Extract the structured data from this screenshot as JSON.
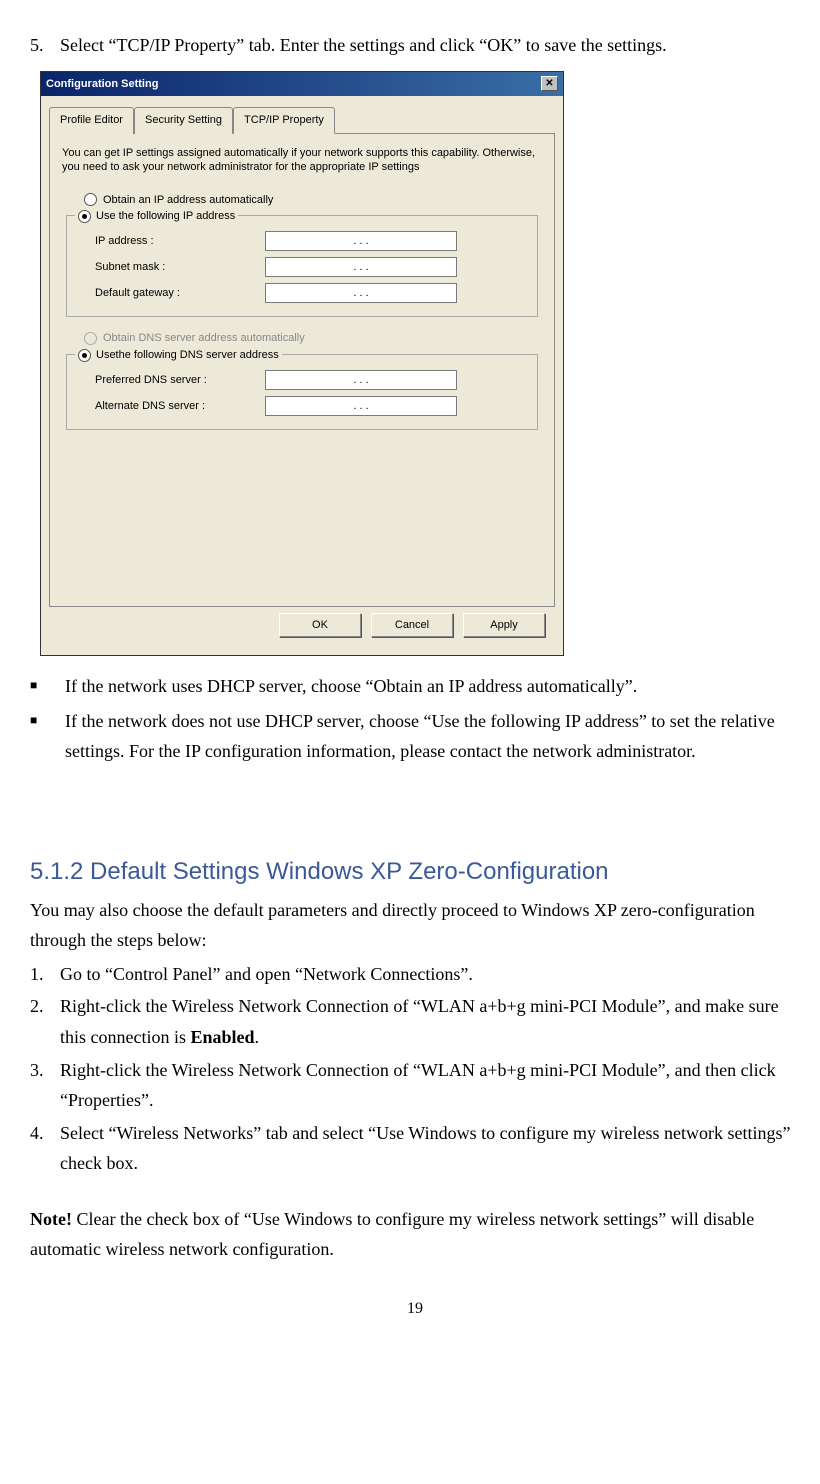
{
  "step5": {
    "num": "5.",
    "text": "Select “TCP/IP Property” tab.  Enter the settings and click “OK” to save the settings."
  },
  "dialog": {
    "title": "Configuration Setting",
    "close": "✕",
    "tabs": {
      "profile": "Profile Editor",
      "security": "Security Setting",
      "tcpip": "TCP/IP Property"
    },
    "intro": "You can get IP settings assigned automatically if your network supports this capability. Otherwise, you need to ask your network administrator for the appropriate IP settings",
    "radio_obtain_ip": "Obtain an IP address automatically",
    "radio_use_ip": "Use the following IP address",
    "ip_label": "IP address :",
    "subnet_label": "Subnet mask :",
    "gateway_label": "Default gateway :",
    "radio_obtain_dns": "Obtain DNS server address automatically",
    "radio_use_dns": "Usethe following DNS server address",
    "pref_dns_label": "Preferred DNS server :",
    "alt_dns_label": "Alternate DNS server :",
    "dots": ".          .          .",
    "ok": "OK",
    "cancel": "Cancel",
    "apply": "Apply"
  },
  "bullets": {
    "b1": "If the network uses DHCP server, choose “Obtain an IP address automatically”.",
    "b2": "If the network does not use DHCP server, choose “Use the following IP address” to set the relative settings.  For the IP configuration information, please contact the network administrator."
  },
  "section": {
    "title": "5.1.2 Default Settings Windows XP Zero-Configuration",
    "intro": "You may also choose the default parameters and directly proceed to Windows XP zero-configuration through the steps below:"
  },
  "steps": {
    "s1num": "1.",
    "s1": "Go to “Control Panel” and open “Network Connections”.",
    "s2num": "2.",
    "s2a": "Right-click the Wireless Network Connection of “WLAN a+b+g mini-PCI Module”, and make sure this connection is ",
    "s2b": "Enabled",
    "s2c": ".",
    "s3num": "3.",
    "s3": "Right-click the Wireless Network Connection of “WLAN a+b+g mini-PCI Module”, and then click “Properties”.",
    "s4num": "4.",
    "s4": "Select “Wireless Networks” tab and select “Use Windows to configure my wireless network settings” check box."
  },
  "note": {
    "label": "Note!",
    "text": " Clear the check box of “Use Windows to configure my wireless network settings” will disable automatic wireless network configuration."
  },
  "pagenum": "19"
}
